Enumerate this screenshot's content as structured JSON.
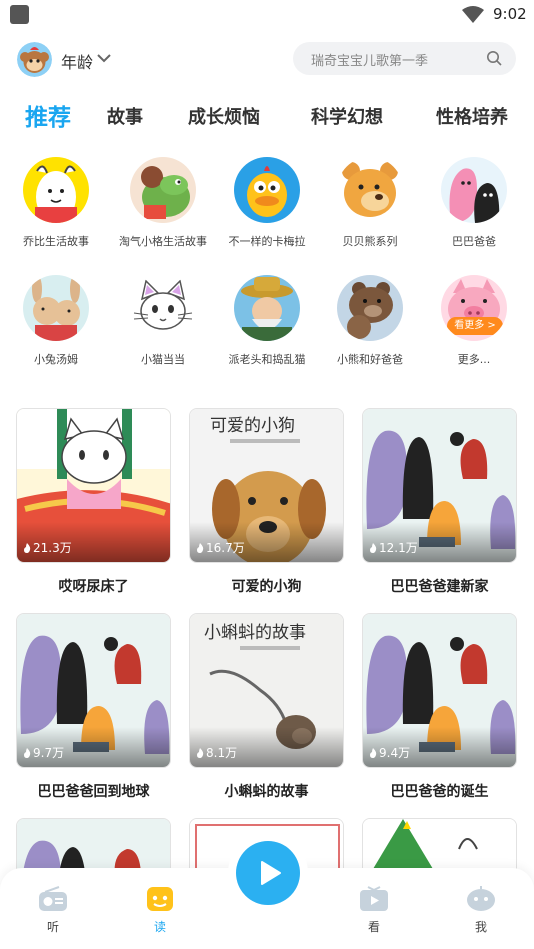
{
  "status": {
    "time": "9:02"
  },
  "header": {
    "age_label": "年龄",
    "search_placeholder": "瑞奇宝宝儿歌第一季"
  },
  "tabs": [
    "推荐",
    "故事",
    "成长烦恼",
    "科学幻想",
    "性格培养"
  ],
  "categories": [
    {
      "name": "乔比生活故事"
    },
    {
      "name": "淘气小格生活故事"
    },
    {
      "name": "不一样的卡梅拉"
    },
    {
      "name": "贝贝熊系列"
    },
    {
      "name": "巴巴爸爸"
    },
    {
      "name": "小兔汤姆"
    },
    {
      "name": "小猫当当"
    },
    {
      "name": "派老头和捣乱猫"
    },
    {
      "name": "小熊和好爸爸"
    },
    {
      "name": "更多...",
      "badge": "看更多 >"
    }
  ],
  "cards": [
    {
      "title": "哎呀尿床了",
      "count": "21.3万"
    },
    {
      "title": "可爱的小狗",
      "count": "16.7万",
      "cover_text": "可爱的小狗"
    },
    {
      "title": "巴巴爸爸建新家",
      "count": "12.1万"
    },
    {
      "title": "巴巴爸爸回到地球",
      "count": "9.7万"
    },
    {
      "title": "小蝌蚪的故事",
      "count": "8.1万",
      "cover_text": "小蝌蚪的故事"
    },
    {
      "title": "巴巴爸爸的诞生",
      "count": "9.4万"
    }
  ],
  "nav": {
    "listen": "听",
    "read": "读",
    "watch": "看",
    "me": "我"
  },
  "colors": {
    "accent": "#1aa6f0",
    "orange": "#ff8a1d"
  }
}
